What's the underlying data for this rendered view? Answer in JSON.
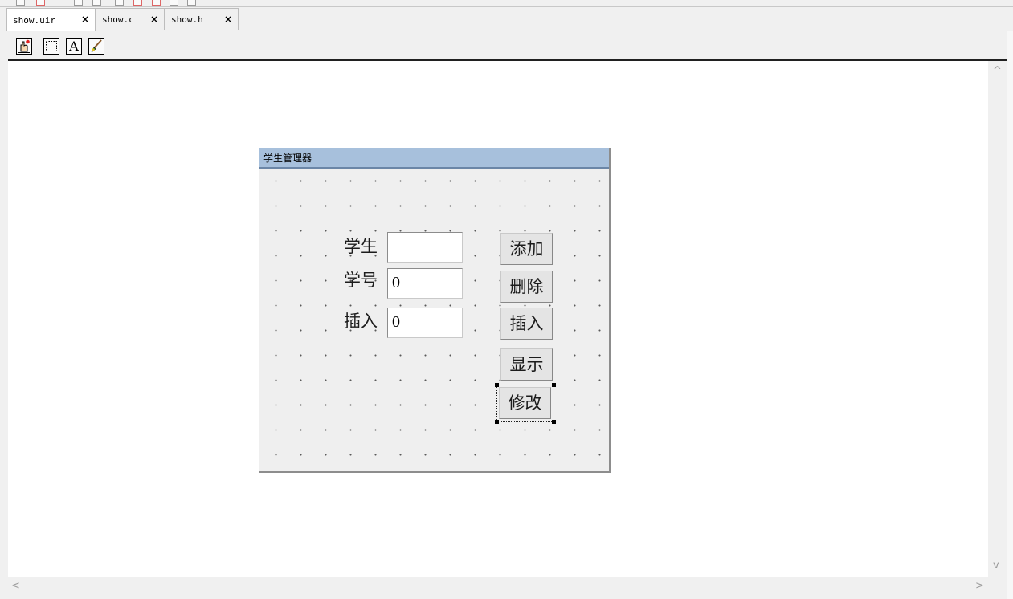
{
  "tabs": [
    {
      "label": "show.uir",
      "close": "×",
      "active": true
    },
    {
      "label": "show.c",
      "close": "×",
      "active": false
    },
    {
      "label": "show.h",
      "close": "×",
      "active": false
    }
  ],
  "toolbar": {
    "tools": [
      "operate-tool-icon",
      "select-region-tool-icon",
      "text-tool-icon",
      "color-tool-icon"
    ],
    "text_tool_label": "A"
  },
  "panel": {
    "title": "学生管理器",
    "fields": [
      {
        "label": "学生",
        "value": ""
      },
      {
        "label": "学号",
        "value": "0"
      },
      {
        "label": "插入",
        "value": "0"
      }
    ],
    "buttons": [
      "添加",
      "删除",
      "插入",
      "显示",
      "修改"
    ],
    "selected_button": "修改"
  },
  "scrollbars": {
    "up": "^",
    "down": "v",
    "left": "<",
    "right": ">"
  },
  "colors": {
    "panel_title_bg": "#a7c0dc",
    "panel_bg": "#efefef",
    "canvas_bg": "#ffffff"
  }
}
